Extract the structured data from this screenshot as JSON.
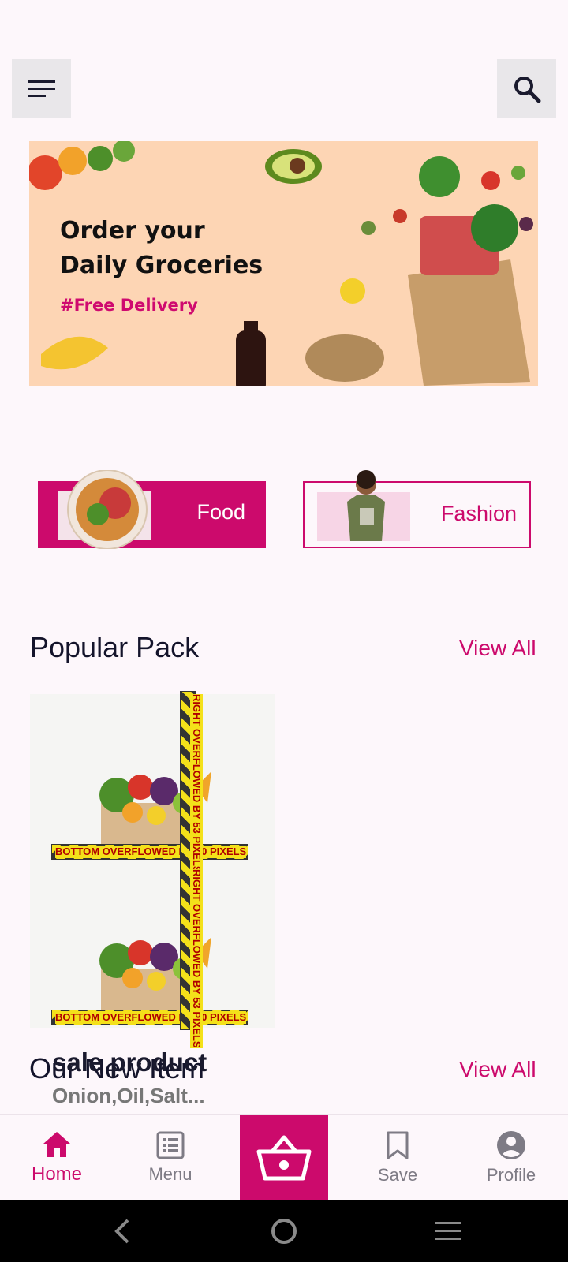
{
  "banner": {
    "title_line1": "Order your",
    "title_line2": "Daily Groceries",
    "tag": "#Free Delivery"
  },
  "categories": [
    {
      "label": "Food"
    },
    {
      "label": "Fashion"
    }
  ],
  "popular": {
    "title": "Popular Pack",
    "view_all": "View All"
  },
  "overflow": {
    "bottom": "BOTTOM OVERFLOWED BY 10 PIXELS",
    "right": "RIGHT OVERFLOWED BY 53 PIXELS"
  },
  "product": {
    "name": "sale product",
    "desc": "Onion,Oil,Salt..."
  },
  "new_items": {
    "title": "Our New Item",
    "view_all": "View All"
  },
  "nav": {
    "home": "Home",
    "menu": "Menu",
    "save": "Save",
    "profile": "Profile"
  },
  "colors": {
    "accent": "#cc0a6c",
    "background": "#fdf7fb"
  }
}
